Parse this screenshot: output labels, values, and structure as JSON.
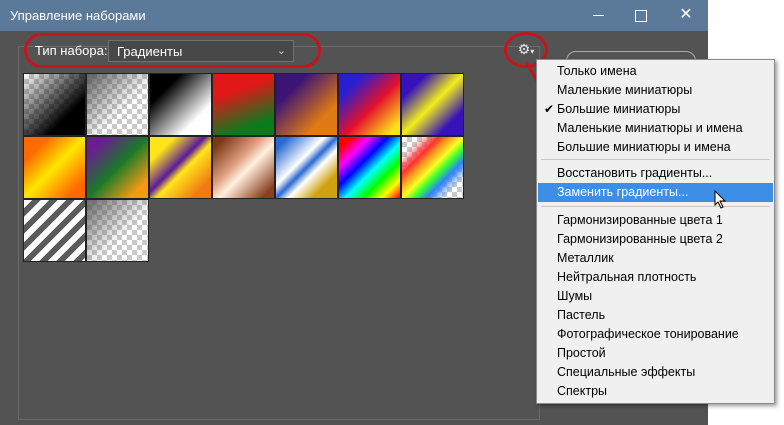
{
  "window": {
    "title": "Управление наборами",
    "controls": {
      "minimize": "–",
      "maximize": "□",
      "close": "✕"
    }
  },
  "preset": {
    "type_label": "Тип набора:",
    "type_value": "Градиенты"
  },
  "gear": {
    "icon": "gear-icon"
  },
  "swatches": [
    {
      "name": "black-transparent"
    },
    {
      "name": "transparent-checker"
    },
    {
      "name": "black-white"
    },
    {
      "name": "red-green"
    },
    {
      "name": "violet-orange"
    },
    {
      "name": "blue-red-yellow"
    },
    {
      "name": "blue-yellow-blue"
    },
    {
      "name": "orange-yellow-orange"
    },
    {
      "name": "violet-green-orange"
    },
    {
      "name": "yellow-violet-orange"
    },
    {
      "name": "copper"
    },
    {
      "name": "chrome"
    },
    {
      "name": "spectrum"
    },
    {
      "name": "transparent-rainbow"
    },
    {
      "name": "transparent-stripes"
    },
    {
      "name": "neutral-transparent"
    }
  ],
  "menu": {
    "items": [
      {
        "label": "Только имена",
        "checked": false,
        "highlighted": false
      },
      {
        "label": "Маленькие миниатюры",
        "checked": false,
        "highlighted": false
      },
      {
        "label": "Большие миниатюры",
        "checked": true,
        "highlighted": false
      },
      {
        "label": "Маленькие миниатюры и имена",
        "checked": false,
        "highlighted": false
      },
      {
        "label": "Большие миниатюры и имена",
        "checked": false,
        "highlighted": false
      },
      {
        "label": "Восстановить градиенты...",
        "checked": false,
        "highlighted": false
      },
      {
        "label": "Заменить градиенты...",
        "checked": false,
        "highlighted": true
      },
      {
        "label": "Гармонизированные цвета 1",
        "checked": false,
        "highlighted": false
      },
      {
        "label": "Гармонизированные цвета 2",
        "checked": false,
        "highlighted": false
      },
      {
        "label": "Металлик",
        "checked": false,
        "highlighted": false
      },
      {
        "label": "Нейтральная плотность",
        "checked": false,
        "highlighted": false
      },
      {
        "label": "Шумы",
        "checked": false,
        "highlighted": false
      },
      {
        "label": "Пастель",
        "checked": false,
        "highlighted": false
      },
      {
        "label": "Фотографическое тонирование",
        "checked": false,
        "highlighted": false
      },
      {
        "label": "Простой",
        "checked": false,
        "highlighted": false
      },
      {
        "label": "Специальные эффекты",
        "checked": false,
        "highlighted": false
      },
      {
        "label": "Спектры",
        "checked": false,
        "highlighted": false
      }
    ],
    "checkmark": "✔"
  },
  "colors": {
    "titlebar": "#5b7a9a",
    "panel": "#535353",
    "highlight": "#3d8ee6",
    "annotation": "#c4151c"
  }
}
